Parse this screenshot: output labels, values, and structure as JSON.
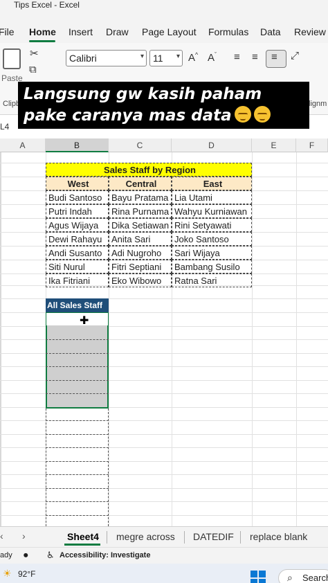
{
  "window": {
    "title": "Tips Excel  -  Excel"
  },
  "ribbon_tabs": [
    "File",
    "Home",
    "Insert",
    "Draw",
    "Page Layout",
    "Formulas",
    "Data",
    "Review"
  ],
  "ribbon": {
    "paste_label": "Paste",
    "clipboard_label": "Clipb",
    "alignment_label": "lignm",
    "font_name": "Calibri",
    "font_size": "11"
  },
  "caption": {
    "line1": "Langsung gw kasih paham",
    "line2": "pake caranya mas data"
  },
  "namebox": "L4",
  "columns": [
    "A",
    "B",
    "C",
    "D",
    "E",
    "F"
  ],
  "table": {
    "title": "Sales Staff by Region",
    "headers": [
      "West",
      "Central",
      "East"
    ],
    "rows": [
      [
        "Budi Santoso",
        "Bayu Pratama",
        "Lia Utami"
      ],
      [
        "Putri Indah",
        "Rina Purnama",
        "Wahyu Kurniawan"
      ],
      [
        "Agus Wijaya",
        "Dika Setiawan",
        "Rini Setyawati"
      ],
      [
        "Dewi Rahayu",
        "Anita Sari",
        "Joko Santoso"
      ],
      [
        "Andi Susanto",
        "Adi Nugroho",
        "Sari Wijaya"
      ],
      [
        "Siti Nurul",
        "Fitri Septiani",
        "Bambang Susilo"
      ],
      [
        "Ika Fitriani",
        "Eko Wibowo",
        "Ratna Sari"
      ]
    ]
  },
  "all_staff_header": "All Sales Staff",
  "sheets": [
    "Sheet4",
    "megre across",
    "DATEDIF",
    "replace blank"
  ],
  "active_sheet": "Sheet4",
  "status": {
    "ready": "Ready",
    "accessibility": "Accessibility: Investigate"
  },
  "taskbar": {
    "weather": "92°F",
    "search": "Search"
  },
  "colors": {
    "excel_green": "#107c41",
    "title_yellow": "#ffff00",
    "header_navy": "#1f4e79",
    "header_tan": "#fde9c6"
  }
}
